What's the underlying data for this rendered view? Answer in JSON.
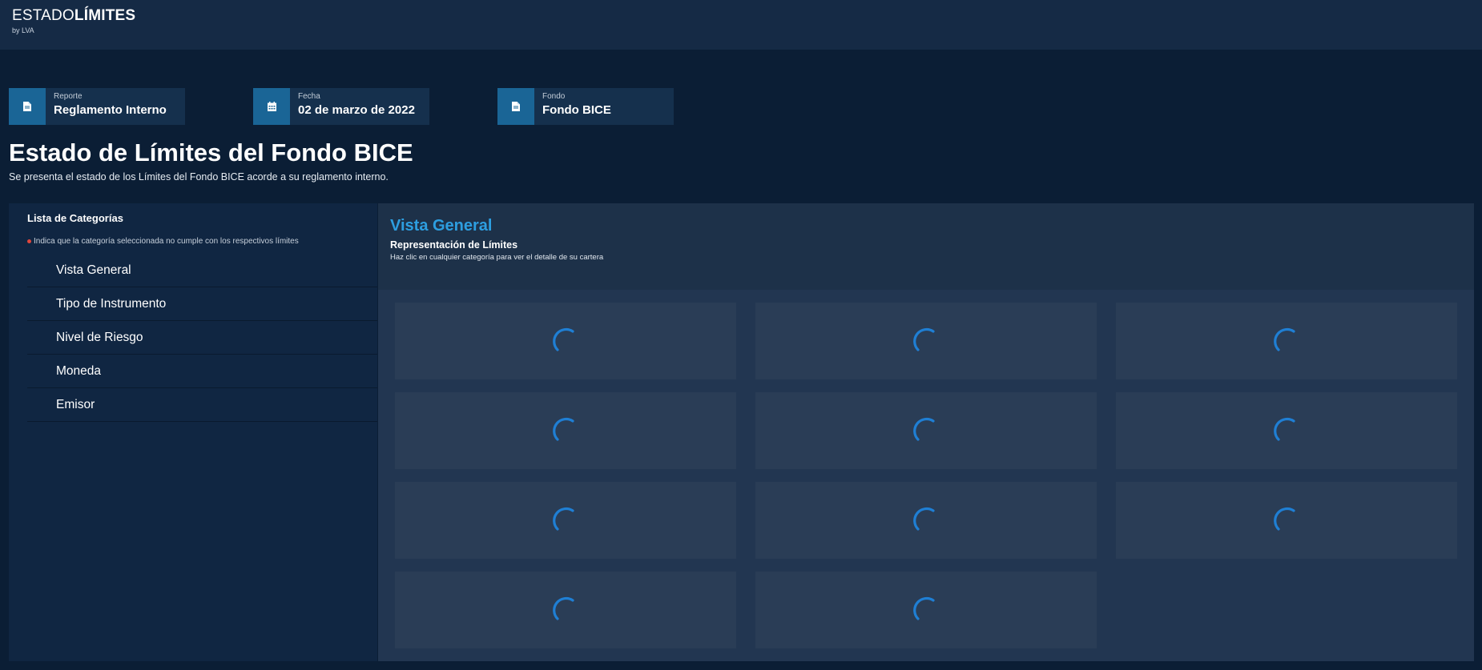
{
  "brand": {
    "name_light": "ESTADO",
    "name_bold": "LÍMITES",
    "sub": "by LVA"
  },
  "info_cards": [
    {
      "icon": "file-icon",
      "label": "Reporte",
      "value": "Reglamento Interno"
    },
    {
      "icon": "calendar-icon",
      "label": "Fecha",
      "value": "02 de marzo de 2022"
    },
    {
      "icon": "file-icon",
      "label": "Fondo",
      "value": "Fondo BICE"
    }
  ],
  "page": {
    "title": "Estado de Límites del Fondo BICE",
    "subtitle": "Se presenta el estado de los Límites del Fondo BICE acorde a su reglamento interno."
  },
  "sidebar": {
    "title": "Lista de Categorías",
    "legend": "Indica que la categoría seleccionada no cumple con los respectivos límites",
    "items": [
      {
        "label": "Vista General"
      },
      {
        "label": "Tipo de Instrumento"
      },
      {
        "label": "Nivel de Riesgo"
      },
      {
        "label": "Moneda"
      },
      {
        "label": "Emisor"
      }
    ]
  },
  "main": {
    "title": "Vista General",
    "section_title": "Representación de Límites",
    "section_hint": "Haz clic en cualquier categoría para ver el detalle de su cartera",
    "tile_count": 11
  },
  "colors": {
    "accent": "#2d9ee0",
    "spinner": "#1f7fd4",
    "icon_bg": "#1a6596",
    "alert_dot": "#e0463c"
  }
}
